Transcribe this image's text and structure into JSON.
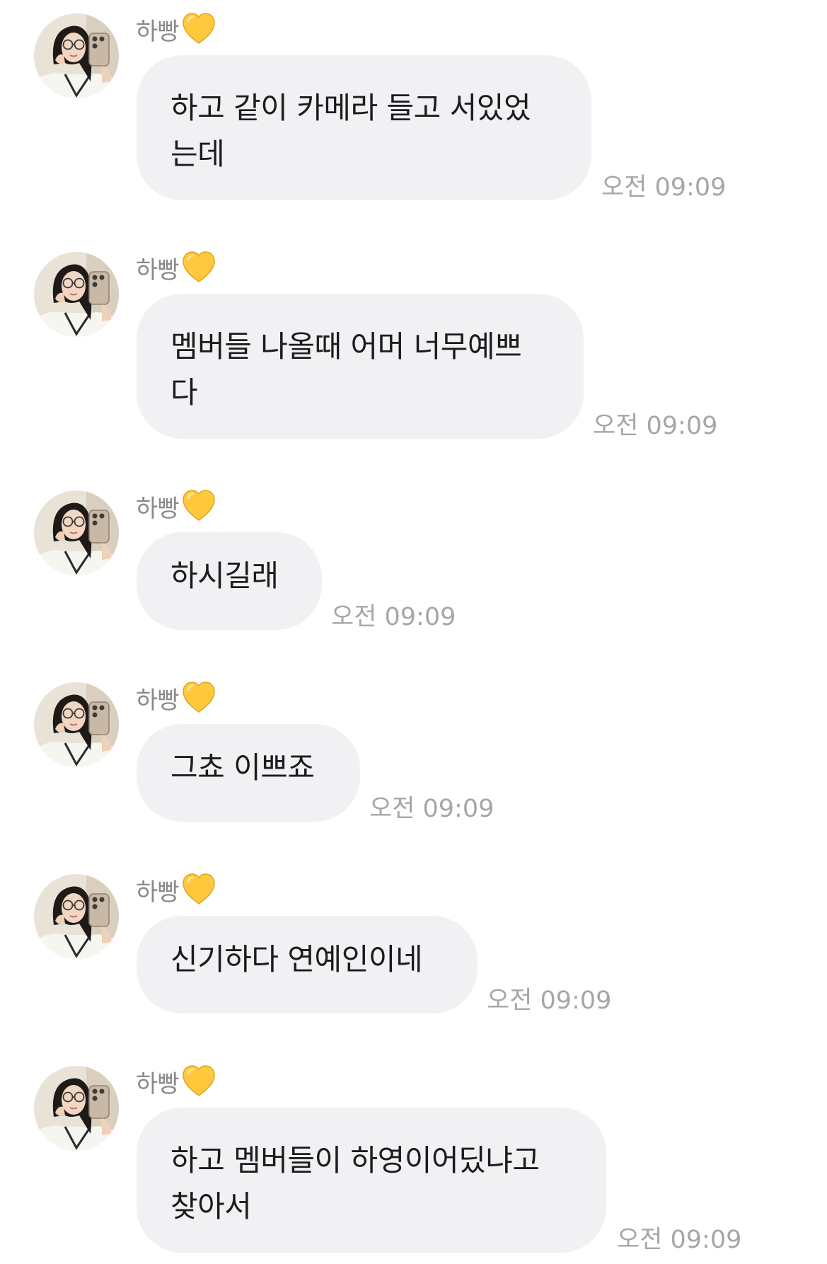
{
  "sender": {
    "name": "하빵",
    "badge_icon": "yellow-heart-icon",
    "badge_color": "#FFC83D"
  },
  "messages": [
    {
      "lines": [
        "하고 같이 카메라 들고 서있었",
        "는데"
      ],
      "time": "오전 09:09"
    },
    {
      "lines": [
        "멤버들 나올때 어머 너무예쁘",
        "다"
      ],
      "time": "오전 09:09"
    },
    {
      "lines": [
        "하시길래"
      ],
      "time": "오전 09:09"
    },
    {
      "lines": [
        "그쵸 이쁘죠"
      ],
      "time": "오전 09:09"
    },
    {
      "lines": [
        "신기하다 연예인이네"
      ],
      "time": "오전 09:09"
    },
    {
      "lines": [
        "하고 멤버들이 하영이어딨냐고",
        "찾아서"
      ],
      "time": "오전 09:09"
    }
  ],
  "colors": {
    "bubble_bg": "#F1F1F3",
    "message_text": "#1C1C1E",
    "sender_text": "#8A8A8E",
    "timestamp_text": "#A6A6AA"
  }
}
